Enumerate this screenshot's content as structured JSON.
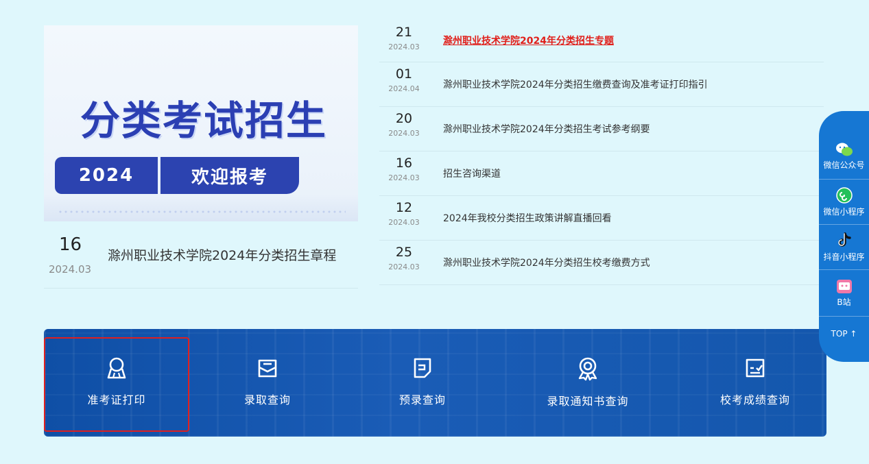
{
  "featured": {
    "banner": {
      "headline": "分类考试招生",
      "year": "2024",
      "slogan": "欢迎报考"
    },
    "day": "16",
    "year_month": "2024.03",
    "title": "滁州职业技术学院2024年分类招生章程"
  },
  "news": [
    {
      "day": "21",
      "year_month": "2024.03",
      "title": "滁州职业技术学院2024年分类招生专题",
      "highlight": true
    },
    {
      "day": "01",
      "year_month": "2024.04",
      "title": "滁州职业技术学院2024年分类招生缴费查询及准考证打印指引"
    },
    {
      "day": "20",
      "year_month": "2024.03",
      "title": "滁州职业技术学院2024年分类招生考试参考纲要"
    },
    {
      "day": "16",
      "year_month": "2024.03",
      "title": "招生咨询渠道"
    },
    {
      "day": "12",
      "year_month": "2024.03",
      "title": "2024年我校分类招生政策讲解直播回看"
    },
    {
      "day": "25",
      "year_month": "2024.03",
      "title": "滁州职业技术学院2024年分类招生校考缴费方式"
    }
  ],
  "quick_links": [
    {
      "label": "准考证打印",
      "icon": "badge-icon"
    },
    {
      "label": "录取查询",
      "icon": "envelope-icon"
    },
    {
      "label": "预录查询",
      "icon": "document-icon"
    },
    {
      "label": "录取通知书查询",
      "icon": "award-icon"
    },
    {
      "label": "校考成绩查询",
      "icon": "chart-icon"
    }
  ],
  "sidebar": {
    "items": [
      {
        "label": "微信公众号",
        "icon": "wechat-icon"
      },
      {
        "label": "微信小程序",
        "icon": "miniprogram-icon"
      },
      {
        "label": "抖音小程序",
        "icon": "douyin-icon"
      },
      {
        "label": "B站",
        "icon": "bilibili-icon"
      }
    ],
    "top": "TOP ↑"
  },
  "colors": {
    "background": "#dff7fc",
    "highlight_red": "#e0201b",
    "panel_blue": "#1457ad",
    "sidebar_blue": "#1677d3",
    "banner_blue": "#2c43b0"
  }
}
